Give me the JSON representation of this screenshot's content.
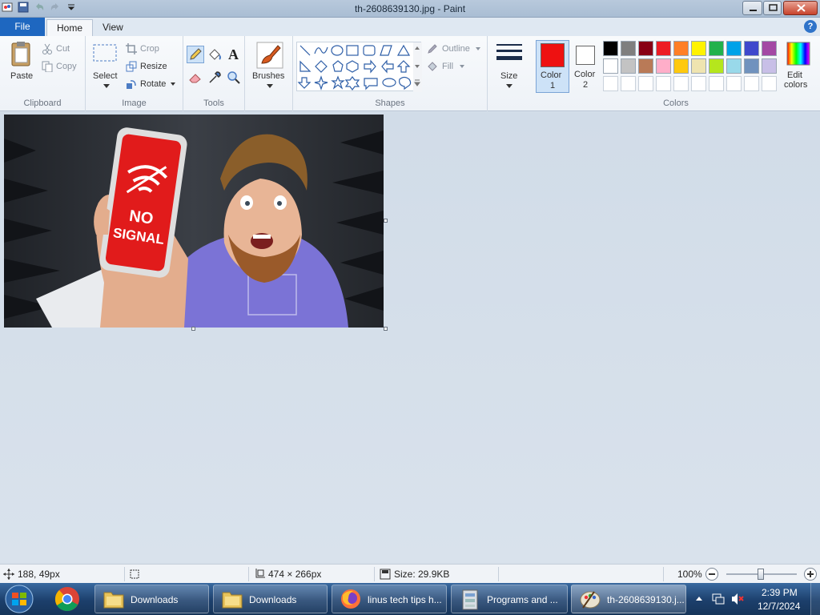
{
  "window": {
    "title": "th-2608639130.jpg - Paint"
  },
  "tabs": {
    "file": "File",
    "home": "Home",
    "view": "View"
  },
  "clipboard": {
    "paste": "Paste",
    "cut": "Cut",
    "copy": "Copy",
    "label": "Clipboard"
  },
  "image_group": {
    "select": "Select",
    "crop": "Crop",
    "resize": "Resize",
    "rotate": "Rotate",
    "label": "Image"
  },
  "tools": {
    "label": "Tools"
  },
  "brushes": {
    "label": "Brushes"
  },
  "shapes": {
    "outline": "Outline",
    "fill": "Fill",
    "label": "Shapes"
  },
  "size": {
    "label": "Size"
  },
  "colors": {
    "color1": "Color",
    "color1_num": "1",
    "color1_value": "#ee1111",
    "color2": "Color",
    "color2_num": "2",
    "color2_value": "#ffffff",
    "edit": "Edit",
    "edit2": "colors",
    "label": "Colors",
    "palette_row1": [
      "#000000",
      "#7f7f7f",
      "#880015",
      "#ed1c24",
      "#ff7f27",
      "#fff200",
      "#22b14c",
      "#00a2e8",
      "#3f48cc",
      "#a349a4"
    ],
    "palette_row2": [
      "#ffffff",
      "#c3c3c3",
      "#b97a57",
      "#ffaec9",
      "#ffc90e",
      "#efe4b0",
      "#b5e61d",
      "#99d9ea",
      "#7092be",
      "#c8bfe7"
    ]
  },
  "canvas_image": {
    "phone_text1": "NO",
    "phone_text2": "SIGNAL"
  },
  "statusbar": {
    "cursor": "188, 49px",
    "dimensions": "474 × 266px",
    "size": "Size: 29.9KB",
    "zoom": "100%"
  },
  "taskbar": {
    "items": [
      {
        "label": "Downloads"
      },
      {
        "label": "Downloads"
      },
      {
        "label": "linus tech tips h..."
      },
      {
        "label": "Programs and ..."
      },
      {
        "label": "th-2608639130.j..."
      }
    ],
    "time": "2:39 PM",
    "date": "12/7/2024"
  }
}
